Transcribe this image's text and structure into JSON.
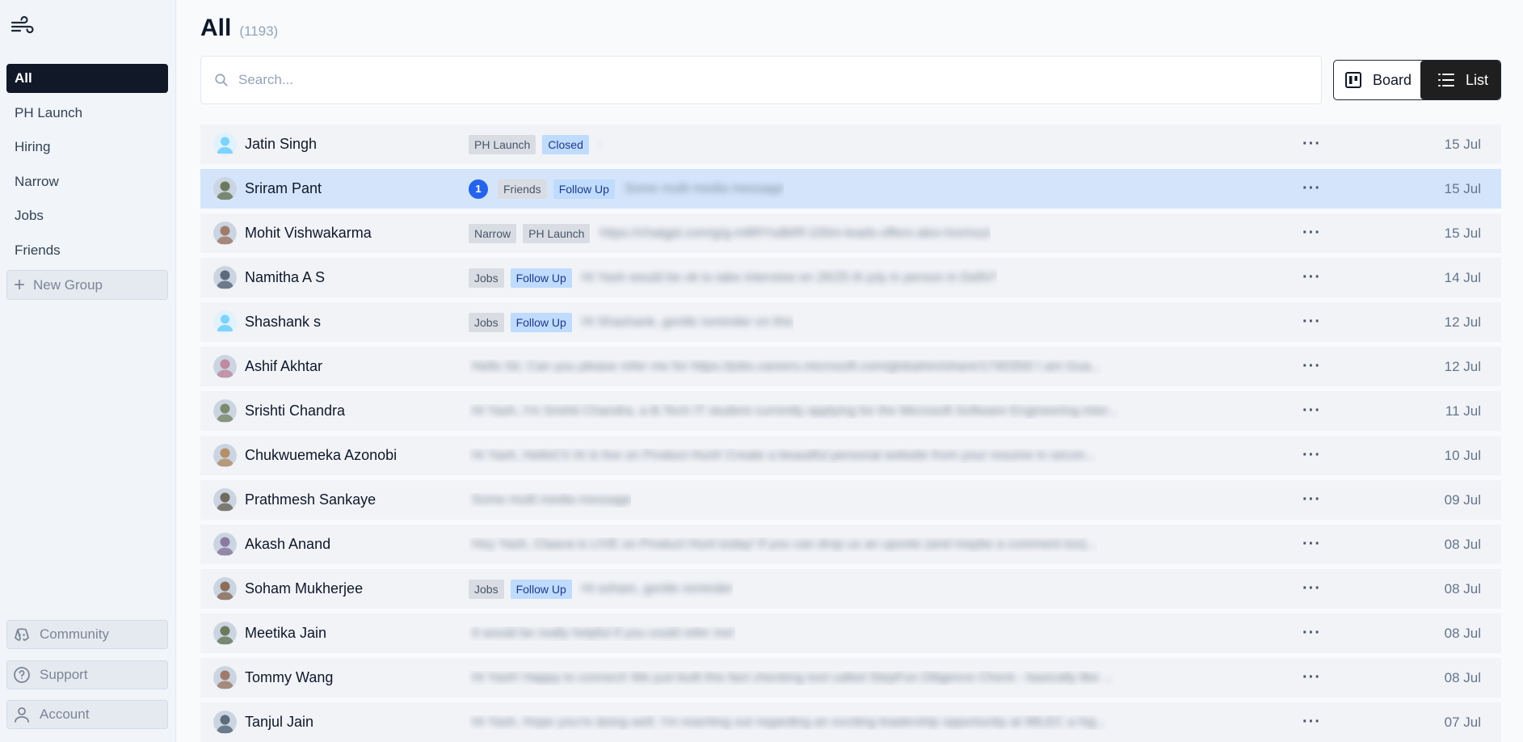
{
  "sidebar": {
    "nav": [
      {
        "label": "All",
        "active": true
      },
      {
        "label": "PH Launch",
        "active": false
      },
      {
        "label": "Hiring",
        "active": false
      },
      {
        "label": "Narrow",
        "active": false
      },
      {
        "label": "Jobs",
        "active": false
      },
      {
        "label": "Friends",
        "active": false
      }
    ],
    "new_group_label": "New Group",
    "bottom": {
      "community_label": "Community",
      "support_label": "Support",
      "account_label": "Account"
    }
  },
  "header": {
    "title": "All",
    "count": "(1193)"
  },
  "search": {
    "placeholder": "Search..."
  },
  "view_toggle": {
    "board_label": "Board",
    "list_label": "List",
    "active": "list"
  },
  "rows": [
    {
      "name": "Jatin Singh",
      "unread": null,
      "tags": [
        {
          "label": "PH Launch",
          "color": "gray"
        },
        {
          "label": "Closed",
          "color": "blue"
        }
      ],
      "preview": "-",
      "date": "15 Jul",
      "avatar": "default-user",
      "selected": false
    },
    {
      "name": "Sriram Pant",
      "unread": "1",
      "tags": [
        {
          "label": "Friends",
          "color": "gray"
        },
        {
          "label": "Follow Up",
          "color": "blue"
        }
      ],
      "preview": "Some multi media message",
      "date": "15 Jul",
      "avatar": "photo",
      "selected": true
    },
    {
      "name": "Mohit Vishwakarma",
      "unread": null,
      "tags": [
        {
          "label": "Narrow",
          "color": "gray"
        },
        {
          "label": "PH Launch",
          "color": "gray"
        }
      ],
      "preview": "https://chatgpt.com/g/g-m8RYsdbRf-100m-leads-offers-alex-hormozi",
      "date": "15 Jul",
      "avatar": "photo",
      "selected": false
    },
    {
      "name": "Namitha A S",
      "unread": null,
      "tags": [
        {
          "label": "Jobs",
          "color": "gray"
        },
        {
          "label": "Follow Up",
          "color": "blue"
        }
      ],
      "preview": "Hi Yash would be ok to take interview on 26/25 th july in person in Delhi?",
      "date": "14 Jul",
      "avatar": "photo",
      "selected": false
    },
    {
      "name": "Shashank s",
      "unread": null,
      "tags": [
        {
          "label": "Jobs",
          "color": "gray"
        },
        {
          "label": "Follow Up",
          "color": "blue"
        }
      ],
      "preview": "Hi Shashank, gentle reminder on this",
      "date": "12 Jul",
      "avatar": "default-user",
      "selected": false
    },
    {
      "name": "Ashif Akhtar",
      "unread": null,
      "tags": [],
      "preview": "Hello Sir, Can you please refer me for https://jobs.careers.microsoft.com/global/en/share/1740350/ I am Gua...",
      "date": "12 Jul",
      "avatar": "photo",
      "selected": false
    },
    {
      "name": "Srishti Chandra",
      "unread": null,
      "tags": [],
      "preview": "Hi Yash, I'm Srishti Chandra, a B.Tech IT student currently applying for the Microsoft Software Engineering inter...",
      "date": "11 Jul",
      "avatar": "photo",
      "selected": false
    },
    {
      "name": "Chukwuemeka Azonobi",
      "unread": null,
      "tags": [],
      "preview": "Hi Yash, HelloCV AI is live on Product Hunt! Create a beautiful personal website from your resume in secon...",
      "date": "10 Jul",
      "avatar": "photo",
      "selected": false
    },
    {
      "name": "Prathmesh Sankaye",
      "unread": null,
      "tags": [],
      "preview": "Some multi media message",
      "date": "09 Jul",
      "avatar": "photo",
      "selected": false
    },
    {
      "name": "Akash Anand",
      "unread": null,
      "tags": [],
      "preview": "Hey Yash, Claava is LIVE on Product Hunt today! If you can drop us an upvote (and maybe a comment too)...",
      "date": "08 Jul",
      "avatar": "photo",
      "selected": false
    },
    {
      "name": "Soham Mukherjee",
      "unread": null,
      "tags": [
        {
          "label": "Jobs",
          "color": "gray"
        },
        {
          "label": "Follow Up",
          "color": "blue"
        }
      ],
      "preview": "Hi soham, gentle reminder",
      "date": "08 Jul",
      "avatar": "photo",
      "selected": false
    },
    {
      "name": "Meetika Jain",
      "unread": null,
      "tags": [],
      "preview": "It would be really helpful if you could refer me!",
      "date": "08 Jul",
      "avatar": "photo",
      "selected": false
    },
    {
      "name": "Tommy Wang",
      "unread": null,
      "tags": [],
      "preview": "Hi Yash! Happy to connect! We just built this fact checking tool called StepFun Diligence Check - basically like ...",
      "date": "08 Jul",
      "avatar": "photo",
      "selected": false
    },
    {
      "name": "Tanjul Jain",
      "unread": null,
      "tags": [],
      "preview": "Hi Yash, Hope you're doing well. I'm reaching out regarding an exciting leadership opportunity at 98LEC a hig...",
      "date": "07 Jul",
      "avatar": "photo",
      "selected": false
    }
  ],
  "colors": {
    "active_nav_bg": "#111827",
    "selected_row_bg": "#d4e5fb",
    "tag_blue_bg": "#bfdbfe",
    "tag_gray_bg": "#d9dde3",
    "badge_blue": "#2563eb"
  }
}
